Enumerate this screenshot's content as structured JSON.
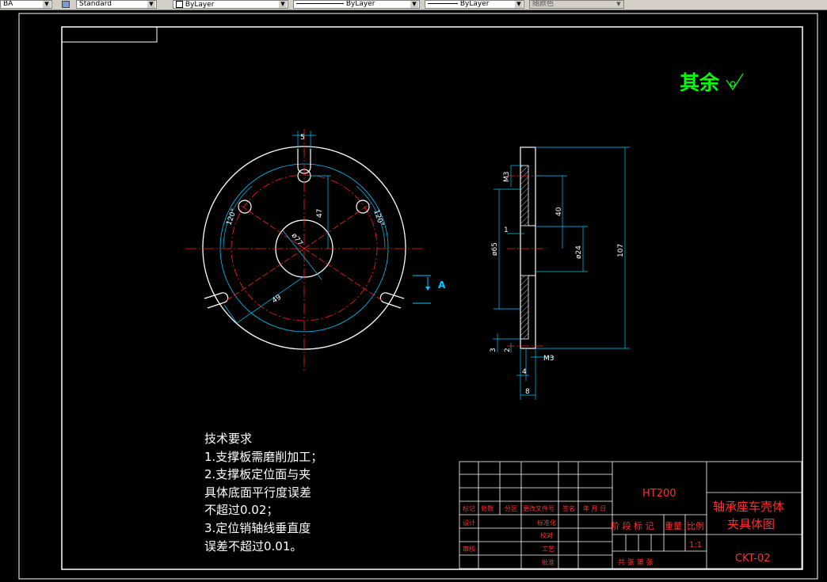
{
  "toolbar": {
    "layer_value": "BA",
    "textstyle_value": "Standard",
    "color_value": "ByLayer",
    "linetype_value": "ByLayer",
    "lineweight_value": "ByLayer",
    "plotstyle_value": "随颜色"
  },
  "drawing": {
    "roughness_label": "其余",
    "section_label": "A",
    "front_view": {
      "dim_slot_width": "5",
      "dim_pin_height": "47",
      "dim_angle_left": "120°",
      "dim_angle_right": "120°",
      "dim_bore": "ø77",
      "dim_radius": "49"
    },
    "side_view": {
      "dim_thread_top": "M3",
      "dim_40": "40",
      "dim_1": "1",
      "dim_phi65": "ø65",
      "dim_phi24": "ø24",
      "dim_107": "107",
      "dim_3": "3",
      "dim_2": "2",
      "dim_thread_bottom": "M3",
      "dim_4": "4",
      "dim_8": "8"
    },
    "notes": {
      "title": "技术要求",
      "line1": "1.支撑板需磨削加工；",
      "line2": "2.支撑板定位面与夹",
      "line3": "具体底面平行度误差",
      "line4": "不超过0.02；",
      "line5": "3.定位销轴线垂直度",
      "line6": "误差不超过0.01。"
    },
    "title_block": {
      "material": "HT200",
      "part_name_line1": "轴承座车壳体",
      "part_name_line2": "夹具体图",
      "drawing_no": "CKT-02",
      "stage_label": "阶 段 标 记",
      "weight_label": "重量",
      "scale_label": "比例",
      "scale_value": "1:1",
      "sheets_label": "共   张  第   张",
      "rev_mark": "标记",
      "rev_count": "处数",
      "rev_zone": "分区",
      "rev_doc": "更改文件号",
      "rev_sign": "签名",
      "rev_date": "年 月 日",
      "designer": "设计",
      "standardize": "标准化",
      "checker": "审核",
      "craft": "工艺",
      "proof": "批准",
      "approve": "校对"
    }
  }
}
